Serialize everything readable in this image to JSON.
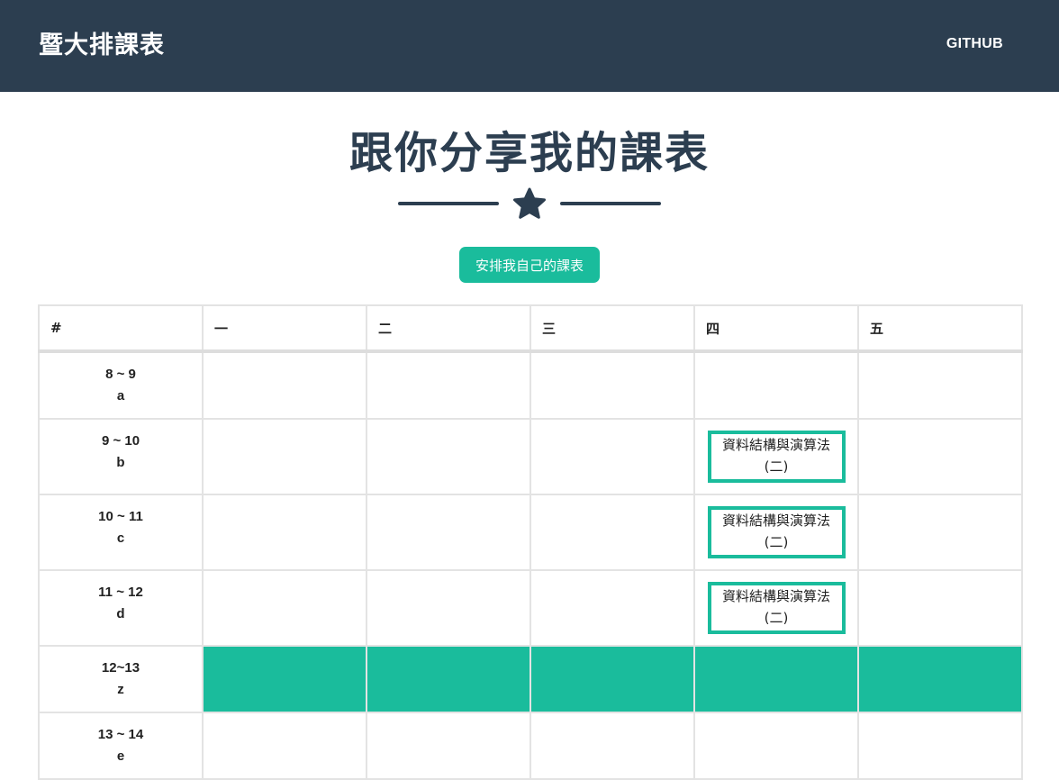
{
  "navbar": {
    "brand": "暨大排課表",
    "github_link": "GITHUB"
  },
  "hero": {
    "title": "跟你分享我的課表",
    "cta_label": "安排我自己的課表"
  },
  "colors": {
    "primary": "#2c3e50",
    "accent": "#1abc9c"
  },
  "icons": {
    "divider": "star-icon"
  },
  "timetable": {
    "headers": [
      "#",
      "一",
      "二",
      "三",
      "四",
      "五"
    ],
    "rows": [
      {
        "time": "8 ~ 9",
        "code": "a",
        "cells": [
          "",
          "",
          "",
          "",
          ""
        ]
      },
      {
        "time": "9 ~ 10",
        "code": "b",
        "cells": [
          "",
          "",
          "",
          "資料結構與演算法(二)",
          ""
        ]
      },
      {
        "time": "10 ~ 11",
        "code": "c",
        "cells": [
          "",
          "",
          "",
          "資料結構與演算法(二)",
          ""
        ]
      },
      {
        "time": "11 ~ 12",
        "code": "d",
        "cells": [
          "",
          "",
          "",
          "資料結構與演算法(二)",
          ""
        ]
      },
      {
        "time": "12~13",
        "code": "z",
        "cells": [
          "",
          "",
          "",
          "",
          ""
        ]
      },
      {
        "time": "13 ~ 14",
        "code": "e",
        "cells": [
          "",
          "",
          "",
          "",
          ""
        ]
      }
    ]
  }
}
